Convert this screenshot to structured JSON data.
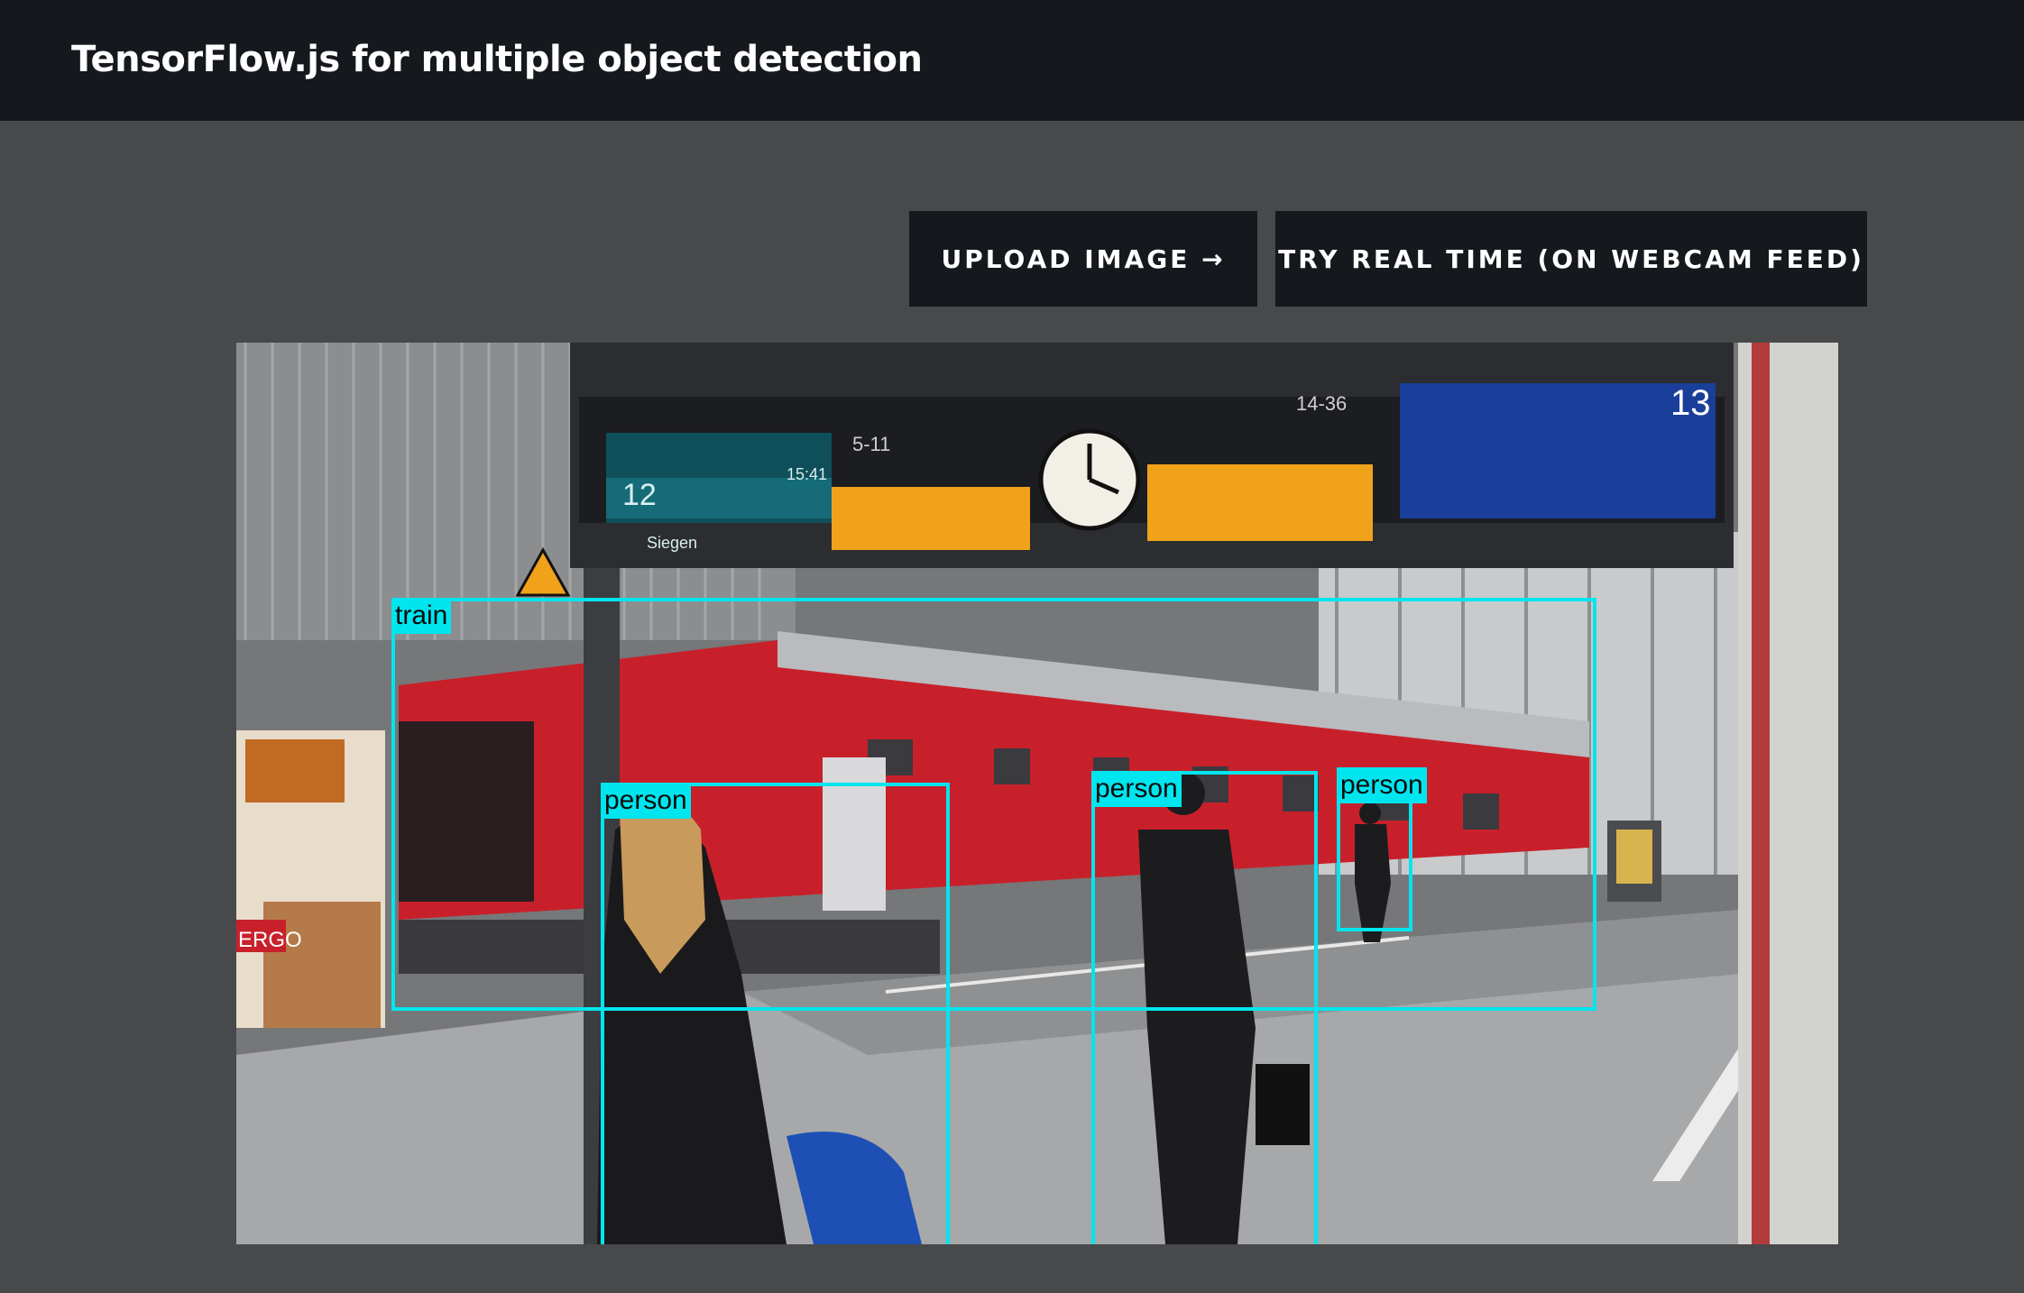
{
  "header": {
    "title": "TensorFlow.js for multiple object detection"
  },
  "actions": {
    "upload_label": "UPLOAD IMAGE →",
    "webcam_label": "TRY REAL TIME (ON WEBCAM FEED)"
  },
  "scene": {
    "platform_number": "12",
    "platform_time": "15:41",
    "platform_destination": "Siegen",
    "board_left_code": "5-11",
    "board_right_code": "14-36",
    "board_track": "13",
    "poster_brand": "ERGO"
  },
  "detections": [
    {
      "label": "train"
    },
    {
      "label": "person"
    },
    {
      "label": "person"
    },
    {
      "label": "person"
    }
  ],
  "colors": {
    "box": "#00e5ee",
    "header_bg": "#15181c",
    "page_bg": "#48494b"
  }
}
